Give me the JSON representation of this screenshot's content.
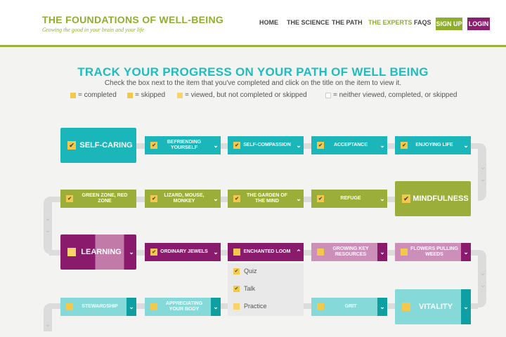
{
  "header": {
    "logo_title": "THE FOUNDATIONS OF WELL-BEING",
    "logo_subtitle": "Growing the good in your brain and your life",
    "nav": [
      "HOME",
      "THE SCIENCE",
      "THE PATH",
      "THE EXPERTS",
      "FAQS"
    ],
    "active_nav": "THE EXPERTS",
    "signup_label": "SIGN UP",
    "login_label": "LOGIN"
  },
  "page": {
    "title": "TRACK YOUR PROGRESS ON YOUR PATH OF WELL BEING",
    "instructions": "Check the box next to the item that you've completed and click on the title on the item to view it.",
    "legend": [
      "= completed",
      "= skipped",
      "= viewed, but not completed or skipped",
      "= neither viewed, completed, or skipped"
    ]
  },
  "path": {
    "row1": [
      "SELF-CARING",
      "BEFRIENDING YOURSELF",
      "SELF-COMPASSION",
      "ACCEPTANCE",
      "ENJOYING LIFE"
    ],
    "row2": [
      "GREEN ZONE, RED ZONE",
      "LIZARD, MOUSE, MONKEY",
      "THE GARDEN OF THE MIND",
      "REFUGE",
      "MINDFULNESS"
    ],
    "row3": [
      "LEARNING",
      "ORDINARY JEWELS",
      "ENCHANTED LOOM",
      "GROWING KEY RESOURCES",
      "FLOWERS PULLING WEEDS"
    ],
    "row4": [
      "STEWARDSHIP",
      "APPRECIATING YOUR BODY",
      "GRIT",
      "VITALITY"
    ]
  },
  "dropdown": {
    "items": [
      "Quiz",
      "Talk",
      "Practice"
    ]
  },
  "colors": {
    "teal": "#1ab6b9",
    "olive": "#9cae3a",
    "plum": "#8a1b6c",
    "pink": "#cc8fb9",
    "aqua": "#85d9d8",
    "checkbox": "#f3c84b"
  },
  "icons": {
    "checkmark": "check-icon",
    "chevron": "chevron-down-icon"
  }
}
